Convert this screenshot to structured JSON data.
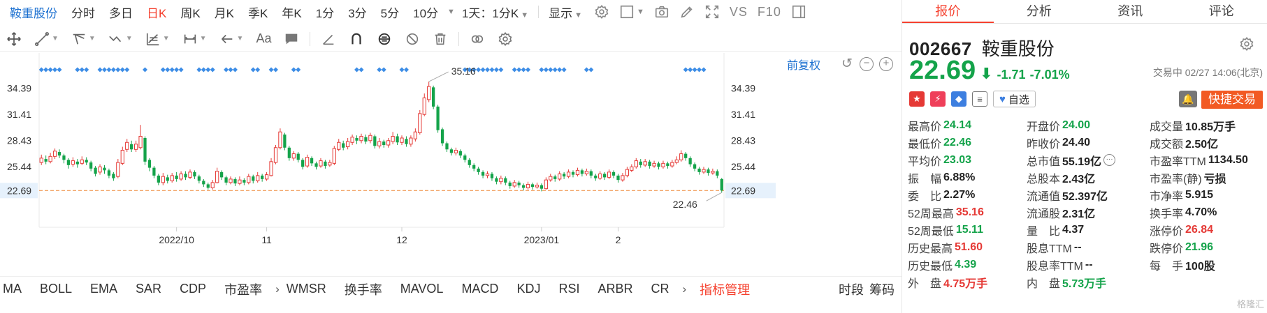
{
  "period_bar": {
    "stock_name": "鞍重股份",
    "items": [
      "分时",
      "多日",
      "日K",
      "周K",
      "月K",
      "季K",
      "年K",
      "1分",
      "3分",
      "5分",
      "10分"
    ],
    "active": "日K",
    "range_select": "1天：1分K",
    "display_label": "显示",
    "vs_label": "VS",
    "f10_label": "F10"
  },
  "draw_bar": {
    "text_tool": "Aa"
  },
  "chart": {
    "restore_label": "前复权",
    "price_label": "22.69"
  },
  "chart_data": {
    "type": "candlestick",
    "y_ticks": [
      34.39,
      31.41,
      28.43,
      25.44,
      22.69
    ],
    "ylim": [
      20.4,
      37.0
    ],
    "x_tick_labels": [
      {
        "label": "2022/10",
        "index": 30
      },
      {
        "label": "11",
        "index": 50
      },
      {
        "label": "12",
        "index": 80
      },
      {
        "label": "2023/01",
        "index": 111
      },
      {
        "label": "2",
        "index": 128
      }
    ],
    "max_annotation": {
      "label": "35.16",
      "index": 86
    },
    "min_annotation": {
      "label": "22.46",
      "index": 151
    },
    "current_price": 22.69,
    "candles": [
      [
        25.9,
        26.4,
        26.8,
        25.6
      ],
      [
        26.3,
        26.0,
        26.7,
        25.7
      ],
      [
        26.0,
        26.6,
        27.0,
        25.8
      ],
      [
        26.6,
        27.2,
        27.5,
        26.3
      ],
      [
        27.1,
        26.7,
        27.4,
        26.4
      ],
      [
        26.7,
        26.2,
        26.9,
        25.8
      ],
      [
        26.2,
        25.6,
        26.4,
        25.2
      ],
      [
        25.7,
        26.1,
        26.5,
        25.4
      ],
      [
        26.0,
        25.7,
        26.3,
        25.3
      ],
      [
        25.8,
        26.2,
        26.6,
        25.6
      ],
      [
        26.2,
        25.9,
        26.5,
        25.6
      ],
      [
        25.9,
        25.2,
        26.1,
        24.9
      ],
      [
        25.3,
        24.6,
        25.5,
        24.3
      ],
      [
        24.8,
        25.4,
        25.7,
        24.5
      ],
      [
        25.3,
        25.0,
        25.6,
        24.6
      ],
      [
        25.0,
        24.4,
        25.2,
        24.1
      ],
      [
        24.6,
        24.1,
        24.8,
        23.8
      ],
      [
        24.3,
        25.9,
        26.3,
        24.1
      ],
      [
        25.8,
        27.3,
        27.7,
        25.6
      ],
      [
        27.4,
        28.2,
        28.6,
        27.1
      ],
      [
        28.0,
        27.4,
        28.4,
        27.1
      ],
      [
        27.4,
        28.0,
        28.4,
        27.1
      ],
      [
        27.6,
        28.9,
        30.2,
        27.4
      ],
      [
        28.7,
        26.0,
        28.9,
        25.6
      ],
      [
        26.2,
        25.3,
        26.4,
        24.9
      ],
      [
        25.3,
        24.4,
        25.5,
        24.1
      ],
      [
        24.4,
        23.6,
        24.6,
        23.3
      ],
      [
        23.6,
        24.3,
        24.7,
        23.3
      ],
      [
        24.2,
        23.8,
        24.5,
        23.5
      ],
      [
        23.8,
        24.4,
        24.7,
        23.6
      ],
      [
        24.4,
        24.0,
        24.8,
        23.7
      ],
      [
        24.0,
        24.6,
        24.9,
        23.8
      ],
      [
        24.6,
        24.2,
        24.9,
        23.9
      ],
      [
        24.2,
        24.8,
        25.1,
        24.0
      ],
      [
        24.8,
        24.3,
        25.0,
        24.0
      ],
      [
        24.3,
        23.8,
        24.5,
        23.5
      ],
      [
        23.8,
        23.4,
        24.0,
        23.1
      ],
      [
        23.4,
        23.0,
        23.6,
        22.8
      ],
      [
        23.0,
        23.6,
        23.9,
        22.8
      ],
      [
        23.6,
        24.9,
        25.3,
        23.5
      ],
      [
        24.8,
        24.2,
        25.0,
        23.9
      ],
      [
        24.2,
        23.6,
        24.4,
        23.3
      ],
      [
        23.6,
        24.0,
        24.3,
        23.4
      ],
      [
        24.0,
        23.5,
        24.2,
        23.2
      ],
      [
        23.5,
        23.9,
        24.3,
        23.3
      ],
      [
        23.9,
        23.6,
        24.1,
        23.3
      ],
      [
        23.6,
        24.3,
        24.6,
        23.4
      ],
      [
        24.3,
        23.8,
        24.5,
        23.5
      ],
      [
        23.8,
        24.4,
        24.8,
        23.6
      ],
      [
        24.4,
        24.0,
        24.6,
        23.7
      ],
      [
        24.0,
        24.5,
        24.8,
        23.8
      ],
      [
        24.4,
        26.0,
        26.4,
        24.3
      ],
      [
        25.9,
        27.6,
        27.9,
        25.7
      ],
      [
        27.6,
        29.4,
        29.8,
        27.4
      ],
      [
        29.1,
        27.6,
        29.3,
        27.3
      ],
      [
        27.6,
        26.4,
        27.8,
        26.1
      ],
      [
        26.4,
        26.9,
        27.2,
        26.1
      ],
      [
        26.9,
        26.2,
        27.1,
        25.9
      ],
      [
        26.2,
        25.4,
        26.4,
        25.1
      ],
      [
        25.5,
        26.5,
        26.8,
        25.3
      ],
      [
        26.4,
        25.8,
        26.6,
        25.5
      ],
      [
        25.8,
        25.4,
        26.0,
        25.1
      ],
      [
        25.5,
        26.1,
        26.4,
        25.3
      ],
      [
        26.0,
        25.5,
        26.2,
        25.2
      ],
      [
        25.6,
        25.9,
        26.2,
        25.4
      ],
      [
        25.8,
        27.5,
        27.8,
        25.6
      ],
      [
        27.4,
        28.2,
        28.6,
        27.2
      ],
      [
        28.1,
        27.6,
        28.4,
        27.3
      ],
      [
        27.7,
        28.3,
        28.7,
        27.4
      ],
      [
        28.2,
        28.8,
        29.1,
        27.9
      ],
      [
        28.7,
        28.4,
        29.0,
        28.0
      ],
      [
        28.4,
        28.9,
        29.2,
        28.1
      ],
      [
        28.8,
        28.3,
        29.1,
        28.0
      ],
      [
        28.4,
        29.0,
        29.3,
        28.1
      ],
      [
        28.9,
        27.8,
        29.1,
        27.5
      ],
      [
        27.8,
        28.3,
        28.7,
        27.5
      ],
      [
        28.3,
        27.9,
        28.5,
        27.6
      ],
      [
        27.9,
        28.4,
        28.7,
        27.6
      ],
      [
        28.3,
        28.9,
        29.4,
        28.0
      ],
      [
        28.9,
        28.2,
        29.2,
        27.9
      ],
      [
        28.2,
        28.7,
        29.0,
        27.9
      ],
      [
        28.6,
        28.0,
        28.9,
        27.7
      ],
      [
        28.0,
        28.7,
        29.0,
        27.7
      ],
      [
        28.6,
        29.4,
        29.8,
        28.3
      ],
      [
        29.3,
        31.5,
        31.9,
        29.1
      ],
      [
        31.4,
        33.3,
        33.8,
        31.2
      ],
      [
        33.1,
        34.6,
        35.16,
        32.8
      ],
      [
        34.5,
        32.3,
        34.7,
        32.0
      ],
      [
        32.3,
        29.6,
        32.5,
        29.3
      ],
      [
        29.7,
        28.1,
        29.9,
        27.8
      ],
      [
        28.1,
        27.4,
        28.3,
        27.1
      ],
      [
        27.4,
        27.0,
        27.6,
        26.7
      ],
      [
        27.0,
        27.3,
        27.6,
        26.7
      ],
      [
        27.2,
        26.7,
        27.4,
        26.4
      ],
      [
        26.7,
        26.2,
        26.9,
        25.9
      ],
      [
        26.2,
        25.6,
        26.4,
        25.3
      ],
      [
        25.6,
        25.2,
        25.8,
        24.9
      ],
      [
        25.2,
        24.8,
        25.4,
        24.5
      ],
      [
        24.8,
        24.4,
        25.0,
        24.1
      ],
      [
        24.4,
        24.6,
        24.9,
        24.1
      ],
      [
        24.6,
        24.1,
        24.8,
        23.8
      ],
      [
        24.1,
        23.7,
        24.3,
        23.4
      ],
      [
        23.7,
        24.1,
        24.4,
        23.4
      ],
      [
        24.1,
        23.6,
        24.3,
        23.3
      ],
      [
        23.6,
        23.2,
        23.8,
        22.9
      ],
      [
        23.2,
        23.6,
        23.9,
        23.0
      ],
      [
        23.6,
        23.3,
        23.8,
        23.0
      ],
      [
        23.3,
        23.0,
        23.5,
        22.7
      ],
      [
        23.0,
        23.4,
        23.7,
        22.8
      ],
      [
        23.4,
        23.1,
        23.6,
        22.8
      ],
      [
        23.1,
        23.3,
        23.6,
        22.9
      ],
      [
        23.3,
        22.9,
        23.5,
        22.6
      ],
      [
        22.9,
        23.9,
        24.2,
        22.8
      ],
      [
        23.9,
        24.3,
        24.6,
        23.7
      ],
      [
        24.3,
        24.0,
        24.5,
        23.7
      ],
      [
        24.0,
        24.6,
        24.9,
        23.8
      ],
      [
        24.6,
        24.3,
        24.8,
        24.0
      ],
      [
        24.3,
        24.8,
        25.1,
        24.1
      ],
      [
        24.8,
        24.5,
        25.0,
        24.2
      ],
      [
        24.5,
        25.0,
        25.3,
        24.3
      ],
      [
        25.0,
        24.6,
        25.2,
        24.3
      ],
      [
        24.6,
        24.9,
        25.2,
        24.4
      ],
      [
        24.9,
        24.4,
        25.1,
        24.1
      ],
      [
        24.4,
        24.1,
        24.6,
        23.8
      ],
      [
        24.1,
        24.6,
        24.9,
        23.9
      ],
      [
        24.6,
        24.2,
        24.8,
        23.9
      ],
      [
        24.2,
        24.8,
        25.1,
        24.0
      ],
      [
        24.8,
        24.4,
        25.0,
        24.1
      ],
      [
        24.4,
        23.9,
        24.6,
        23.6
      ],
      [
        23.9,
        24.4,
        24.7,
        23.7
      ],
      [
        24.4,
        25.1,
        25.4,
        24.2
      ],
      [
        25.0,
        25.4,
        25.7,
        24.8
      ],
      [
        25.4,
        26.1,
        26.4,
        25.2
      ],
      [
        26.0,
        25.6,
        26.3,
        25.3
      ],
      [
        25.6,
        26.0,
        26.3,
        25.4
      ],
      [
        26.0,
        25.5,
        26.2,
        25.2
      ],
      [
        25.5,
        25.8,
        26.1,
        25.3
      ],
      [
        25.8,
        25.4,
        26.0,
        25.1
      ],
      [
        25.4,
        25.8,
        26.1,
        25.2
      ],
      [
        25.8,
        25.5,
        26.0,
        25.2
      ],
      [
        25.5,
        25.9,
        26.2,
        25.3
      ],
      [
        25.9,
        26.2,
        26.6,
        25.7
      ],
      [
        26.2,
        26.9,
        27.3,
        26.0
      ],
      [
        26.9,
        26.4,
        27.1,
        26.1
      ],
      [
        26.4,
        25.7,
        26.6,
        25.4
      ],
      [
        25.7,
        25.2,
        25.9,
        24.9
      ],
      [
        25.2,
        24.8,
        25.4,
        24.5
      ],
      [
        24.8,
        25.1,
        25.4,
        24.6
      ],
      [
        25.1,
        24.7,
        25.3,
        24.4
      ],
      [
        24.7,
        24.9,
        25.2,
        24.5
      ],
      [
        24.9,
        24.4,
        25.1,
        24.1
      ],
      [
        24.0,
        22.69,
        24.14,
        22.46
      ]
    ]
  },
  "indicators": [
    "MA",
    "BOLL",
    "EMA",
    "SAR",
    "CDP",
    "市盈率",
    "WMSR",
    "换手率",
    "MAVOL",
    "MACD",
    "KDJ",
    "RSI",
    "ARBR",
    "CR"
  ],
  "indicator_manage": "指标管理",
  "bottom_right": [
    "时段",
    "筹码"
  ],
  "panel": {
    "tabs": [
      "报价",
      "分析",
      "资讯",
      "评论"
    ],
    "active_tab": "报价",
    "code": "002667",
    "name": "鞍重股份",
    "price": "22.69",
    "change": "-1.71",
    "change_pct": "-7.01%",
    "status": "交易中 02/27 14:06(北京)",
    "fav_label": "自选",
    "quick_trade": "快捷交易",
    "quotes": [
      [
        {
          "l": "最高价",
          "v": "24.14",
          "c": "down"
        },
        {
          "l": "开盘价",
          "v": "24.00",
          "c": "down"
        },
        {
          "l": "成交量",
          "v": "10.85万手",
          "c": "neutral"
        }
      ],
      [
        {
          "l": "最低价",
          "v": "22.46",
          "c": "down"
        },
        {
          "l": "昨收价",
          "v": "24.40",
          "c": "neutral"
        },
        {
          "l": "成交额",
          "v": "2.50亿",
          "c": "neutral"
        }
      ],
      [
        {
          "l": "平均价",
          "v": "23.03",
          "c": "down"
        },
        {
          "l": "总市值",
          "v": "55.19亿",
          "c": "neutral",
          "more": true
        },
        {
          "l": "市盈率TTM",
          "v": "1134.50",
          "c": "neutral"
        }
      ],
      [
        {
          "l": "振　幅",
          "v": "6.88%",
          "c": "neutral"
        },
        {
          "l": "总股本",
          "v": "2.43亿",
          "c": "neutral"
        },
        {
          "l": "市盈率(静)",
          "v": "亏损",
          "c": "neutral"
        }
      ],
      [
        {
          "l": "委　比",
          "v": "2.27%",
          "c": "neutral"
        },
        {
          "l": "流通值",
          "v": "52.397亿",
          "c": "neutral"
        },
        {
          "l": "市净率",
          "v": "5.915",
          "c": "neutral"
        }
      ],
      [
        {
          "l": "52周最高",
          "v": "35.16",
          "c": "up"
        },
        {
          "l": "流通股",
          "v": "2.31亿",
          "c": "neutral"
        },
        {
          "l": "换手率",
          "v": "4.70%",
          "c": "neutral"
        }
      ],
      [
        {
          "l": "52周最低",
          "v": "15.11",
          "c": "down"
        },
        {
          "l": "量　比",
          "v": "4.37",
          "c": "neutral"
        },
        {
          "l": "涨停价",
          "v": "26.84",
          "c": "up"
        }
      ],
      [
        {
          "l": "历史最高",
          "v": "51.60",
          "c": "up"
        },
        {
          "l": "股息TTM",
          "v": "--",
          "c": "neutral"
        },
        {
          "l": "跌停价",
          "v": "21.96",
          "c": "down"
        }
      ],
      [
        {
          "l": "历史最低",
          "v": "4.39",
          "c": "down"
        },
        {
          "l": "股息率TTM",
          "v": "--",
          "c": "neutral"
        },
        {
          "l": "每　手",
          "v": "100股",
          "c": "neutral"
        }
      ],
      [
        {
          "l": "外　盘",
          "v": "4.75万手",
          "c": "up"
        },
        {
          "l": "内　盘",
          "v": "5.73万手",
          "c": "down"
        },
        {
          "l": "",
          "v": "",
          "c": "neutral"
        }
      ]
    ],
    "watermark": "格隆汇"
  },
  "colors": {
    "up": "#e53935",
    "down": "#14a34a",
    "accent": "#1a6fd0",
    "active": "#f5402e",
    "signal_dot": "#3d8de6",
    "dashed_line": "#f09a55"
  }
}
